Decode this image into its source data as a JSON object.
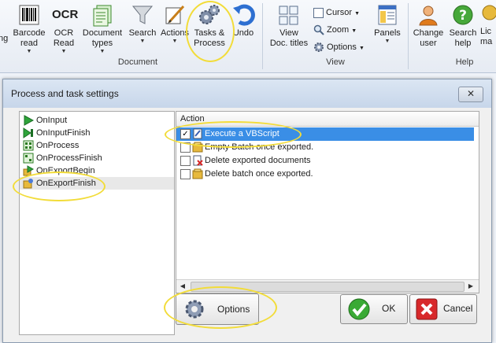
{
  "ribbon": {
    "buttons": [
      {
        "label": "ng",
        "icon": "partial-icon"
      },
      {
        "label": "Barcode\nread",
        "icon": "barcode-icon"
      },
      {
        "label": "OCR\nRead",
        "icon": "ocr-icon",
        "icon_text": "OCR"
      },
      {
        "label": "Document\ntypes",
        "icon": "document-types-icon"
      },
      {
        "label": "Search",
        "icon": "funnel-icon"
      },
      {
        "label": "Actions",
        "icon": "actions-icon"
      },
      {
        "label": "Tasks &\nProcess",
        "icon": "gears-icon"
      },
      {
        "label": "Undo",
        "icon": "undo-icon"
      },
      {
        "label": "View\nDoc. titles",
        "icon": "view-doc-titles-icon"
      },
      {
        "label": "Panels",
        "icon": "panels-icon"
      },
      {
        "label": "Change\nuser",
        "icon": "user-icon"
      },
      {
        "label": "Search\nhelp",
        "icon": "help-icon"
      },
      {
        "label": "Lic\nma",
        "icon": "license-icon"
      }
    ],
    "small_buttons": [
      {
        "label": "Cursor",
        "icon": "cursor-icon"
      },
      {
        "label": "Zoom",
        "icon": "zoom-icon"
      },
      {
        "label": "Options",
        "icon": "gear-icon"
      }
    ],
    "groups": {
      "document": "Document",
      "view": "View",
      "help": "Help"
    }
  },
  "dialog": {
    "title": "Process and task settings",
    "close_label": "✕",
    "events": [
      {
        "label": "OnInput",
        "icon": "play-icon"
      },
      {
        "label": "OnInputFinish",
        "icon": "play-finish-icon"
      },
      {
        "label": "OnProcess",
        "icon": "process-icon"
      },
      {
        "label": "OnProcessFinish",
        "icon": "process-finish-icon"
      },
      {
        "label": "OnExportBegin",
        "icon": "export-begin-icon"
      },
      {
        "label": "OnExportFinish",
        "icon": "export-finish-icon",
        "selected": true
      }
    ],
    "action_header": "Action",
    "actions": [
      {
        "label": "Execute a VBScript",
        "checked": true,
        "selected": true,
        "icon": "script-icon"
      },
      {
        "label": "Empty Batch once exported.",
        "checked": false,
        "icon": "batch-icon"
      },
      {
        "label": "Delete exported documents",
        "checked": false,
        "icon": "delete-documents-icon"
      },
      {
        "label": "Delete batch once exported.",
        "checked": false,
        "icon": "batch-icon"
      }
    ],
    "check_mark": "✓",
    "buttons": {
      "options": "Options",
      "ok": "OK",
      "cancel": "Cancel"
    }
  },
  "colors": {
    "highlight": "#f2dc39",
    "selection": "#3a8ee6"
  }
}
